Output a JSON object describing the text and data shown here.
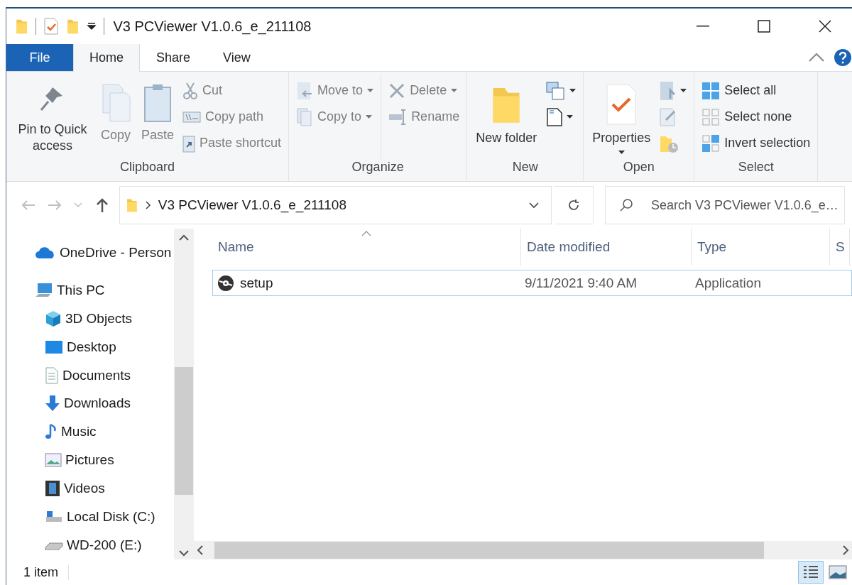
{
  "window": {
    "title": "V3 PCViewer V1.0.6_e_211108"
  },
  "ribbon_tabs": [
    {
      "label": "File",
      "kind": "file",
      "selected": false
    },
    {
      "label": "Home",
      "kind": "tab",
      "selected": true
    },
    {
      "label": "Share",
      "kind": "tab",
      "selected": false
    },
    {
      "label": "View",
      "kind": "tab",
      "selected": false
    }
  ],
  "ribbon_groups": [
    {
      "label": "Clipboard",
      "columns": [
        [
          {
            "kind": "large",
            "label": "Pin to Quick access",
            "disabled": false,
            "dropdown": false
          }
        ],
        [
          {
            "kind": "large",
            "label": "Copy",
            "disabled": true,
            "dropdown": false
          }
        ],
        [
          {
            "kind": "large",
            "label": "Paste",
            "disabled": true,
            "dropdown": false
          }
        ],
        [
          {
            "kind": "small",
            "label": "Cut",
            "disabled": true,
            "dropdown": false
          },
          {
            "kind": "small",
            "label": "Copy path",
            "disabled": true,
            "dropdown": false
          },
          {
            "kind": "small",
            "label": "Paste shortcut",
            "disabled": true,
            "dropdown": false
          }
        ]
      ]
    },
    {
      "label": "Organize",
      "columns": [
        [
          {
            "kind": "small",
            "label": "Move to",
            "disabled": true,
            "dropdown": true
          },
          {
            "kind": "small",
            "label": "Copy to",
            "disabled": true,
            "dropdown": true
          }
        ],
        [
          {
            "kind": "small",
            "label": "Delete",
            "disabled": true,
            "dropdown": true
          },
          {
            "kind": "small",
            "label": "Rename",
            "disabled": true,
            "dropdown": false
          }
        ]
      ]
    },
    {
      "label": "New",
      "columns": [
        [
          {
            "kind": "large",
            "label": "New folder",
            "disabled": false,
            "dropdown": false
          }
        ],
        [
          {
            "kind": "icon",
            "dropdown": true
          },
          {
            "kind": "icon",
            "dropdown": true
          }
        ]
      ]
    },
    {
      "label": "Open",
      "columns": [
        [
          {
            "kind": "large",
            "label": "Properties",
            "disabled": false,
            "dropdown": true
          }
        ],
        [
          {
            "kind": "icon",
            "dropdown": true
          },
          {
            "kind": "icon",
            "dropdown": false
          },
          {
            "kind": "icon",
            "dropdown": false
          }
        ]
      ]
    },
    {
      "label": "Select",
      "columns": [
        [
          {
            "kind": "small",
            "label": "Select all",
            "disabled": false,
            "dropdown": false
          },
          {
            "kind": "small",
            "label": "Select none",
            "disabled": false,
            "dropdown": false
          },
          {
            "kind": "small",
            "label": "Invert selection",
            "disabled": false,
            "dropdown": false
          }
        ]
      ]
    }
  ],
  "nav_buttons": [
    {
      "kind": "back",
      "disabled": true
    },
    {
      "kind": "forward",
      "disabled": true
    },
    {
      "kind": "recent",
      "disabled": true
    },
    {
      "kind": "up",
      "disabled": false
    }
  ],
  "address": {
    "crumbs": [
      "V3 PCViewer V1.0.6_e_211108"
    ]
  },
  "search": {
    "placeholder": "Search V3 PCViewer V1.0.6_e…"
  },
  "navigation_pane": {
    "items": [
      {
        "label": "OneDrive - Person",
        "kind": "cloud"
      },
      {
        "label": "This PC",
        "kind": "pc",
        "children": [
          {
            "label": "3D Objects",
            "kind": "objects"
          },
          {
            "label": "Desktop",
            "kind": "desktop"
          },
          {
            "label": "Documents",
            "kind": "documents"
          },
          {
            "label": "Downloads",
            "kind": "downloads"
          },
          {
            "label": "Music",
            "kind": "music"
          },
          {
            "label": "Pictures",
            "kind": "pictures"
          },
          {
            "label": "Videos",
            "kind": "videos"
          },
          {
            "label": "Local Disk (C:)",
            "kind": "disk"
          },
          {
            "label": "WD-200 (E:)",
            "kind": "drive"
          }
        ]
      }
    ]
  },
  "file_list": {
    "columns": [
      {
        "label": "Name",
        "sorted": true
      },
      {
        "label": "Date modified",
        "sorted": false
      },
      {
        "label": "Type",
        "sorted": false
      },
      {
        "label": "S",
        "sorted": false
      }
    ],
    "rows": [
      {
        "name": "setup",
        "date_modified": "9/11/2021 9:40 AM",
        "type": "Application",
        "focused": true
      }
    ]
  },
  "status_bar": {
    "item_count": "1 item",
    "view_buttons": [
      {
        "kind": "details",
        "selected": true
      },
      {
        "kind": "thumbnails",
        "selected": false
      }
    ]
  }
}
